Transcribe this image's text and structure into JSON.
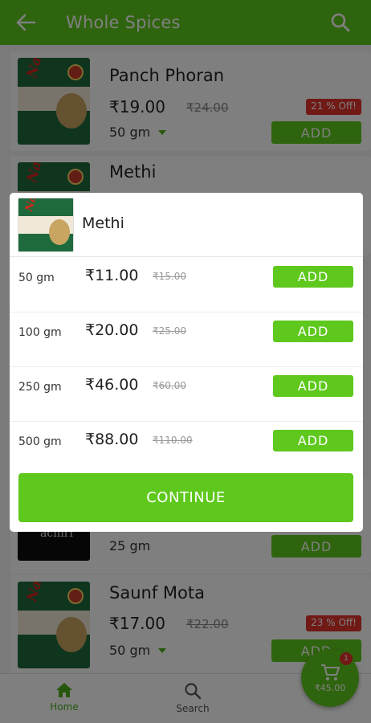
{
  "appbar": {
    "title": "Whole Spices"
  },
  "products": [
    {
      "name": "Panch Phoran",
      "price": "₹19.00",
      "mrp": "₹24.00",
      "discount": "21 % Off!",
      "weight": "50 gm",
      "add_label": "ADD"
    },
    {
      "name": "Methi"
    },
    {
      "weight": "25 gm",
      "add_label": "ADD",
      "brand_text": "achiri"
    },
    {
      "name": "Saunf Mota",
      "price": "₹17.00",
      "mrp": "₹22.00",
      "discount": "23 % Off!",
      "weight": "50 gm",
      "add_label": "ADD"
    }
  ],
  "package_brand": "Nature",
  "dialog": {
    "title": "Methi",
    "variants": [
      {
        "weight": "50 gm",
        "price": "₹11.00",
        "mrp": "₹15.00",
        "add_label": "ADD"
      },
      {
        "weight": "100 gm",
        "price": "₹20.00",
        "mrp": "₹25.00",
        "add_label": "ADD"
      },
      {
        "weight": "250 gm",
        "price": "₹46.00",
        "mrp": "₹60.00",
        "add_label": "ADD"
      },
      {
        "weight": "500 gm",
        "price": "₹88.00",
        "mrp": "₹110.00",
        "add_label": "ADD"
      }
    ],
    "continue_label": "CONTINUE"
  },
  "bottom_nav": [
    {
      "label": "Home",
      "icon": "home-icon",
      "active": true
    },
    {
      "label": "Search",
      "icon": "search-icon",
      "active": false
    }
  ],
  "cart": {
    "amount": "₹45.00",
    "count": "1",
    "icon": "cart-icon"
  },
  "colors": {
    "primary": "#5ec81c",
    "discount": "#e0332b",
    "scrim": "rgba(0,0,0,0.5)"
  }
}
